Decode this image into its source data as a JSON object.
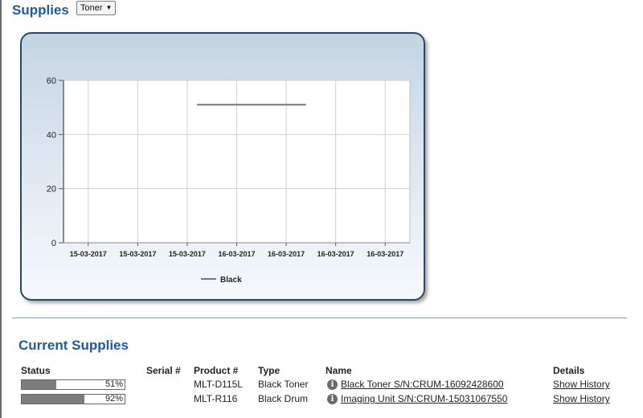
{
  "header": {
    "title": "Supplies",
    "select_value": "Toner"
  },
  "colors": {
    "accent": "#1f5b94",
    "series": "#777777",
    "fill": "#7d7d7d"
  },
  "chart_data": {
    "type": "line",
    "categories": [
      "15-03-2017",
      "15-03-2017",
      "15-03-2017",
      "16-03-2017",
      "16-03-2017",
      "16-03-2017",
      "16-03-2017"
    ],
    "ylim": [
      0,
      60
    ],
    "yticks": [
      0,
      20,
      40,
      60
    ],
    "grid": true,
    "legend": "bottom-center",
    "series": [
      {
        "name": "Black",
        "x_start": 2.2,
        "x_end": 4.4,
        "value": 51
      }
    ]
  },
  "supplies": {
    "title": "Current Supplies",
    "headers": {
      "status": "Status",
      "serial": "Serial #",
      "product": "Product #",
      "type": "Type",
      "name": "Name",
      "details": "Details"
    },
    "rows": [
      {
        "percent": 51,
        "percent_label": "51%",
        "serial": "",
        "product": "MLT-D115L",
        "type": "Black Toner",
        "name": "Black Toner S/N:CRUM-16092428600",
        "details": "Show History"
      },
      {
        "percent": 92,
        "percent_label": "92%",
        "serial": "",
        "product": "MLT-R116",
        "type": "Black Drum",
        "name": "Imaging Unit S/N:CRUM-15031067550",
        "details": "Show History"
      }
    ]
  }
}
